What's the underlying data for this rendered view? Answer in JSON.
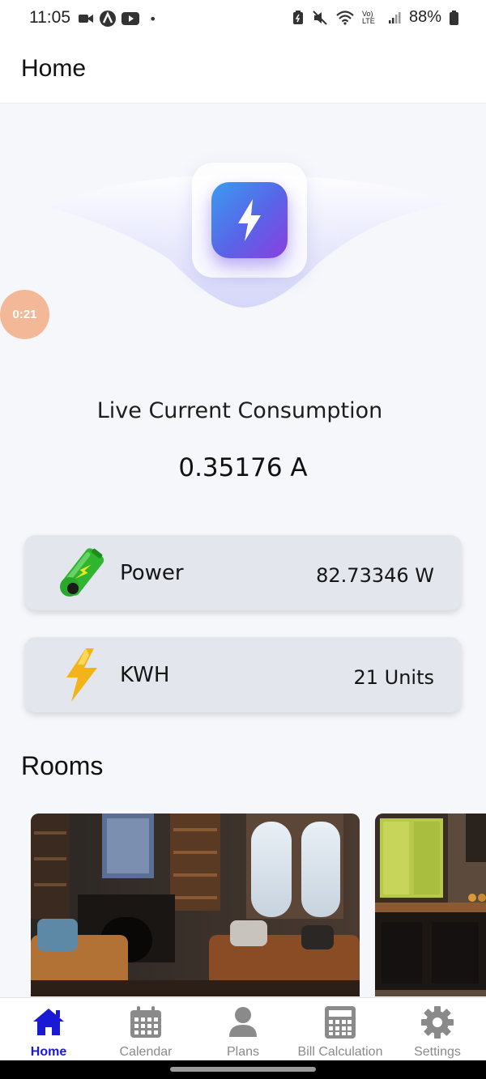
{
  "status_bar": {
    "time": "11:05",
    "dot": "•",
    "volte": "Vo) LTE",
    "battery": "88%"
  },
  "header": {
    "title": "Home"
  },
  "timer_badge": "0:21",
  "consumption": {
    "label": "Live Current Consumption",
    "value": "0.35176 A"
  },
  "cards": [
    {
      "label": "Power",
      "value": "82.73346 W",
      "icon": "battery-icon"
    },
    {
      "label": "KWH",
      "value": "21 Units",
      "icon": "lightning-icon"
    }
  ],
  "rooms": {
    "title": "Rooms",
    "items": [
      {
        "image": "living-room-image"
      },
      {
        "image": "kitchen-image"
      }
    ]
  },
  "nav": {
    "items": [
      {
        "label": "Home",
        "icon": "home-icon",
        "active": true
      },
      {
        "label": "Calendar",
        "icon": "calendar-icon",
        "active": false
      },
      {
        "label": "Plans",
        "icon": "person-icon",
        "active": false
      },
      {
        "label": "Bill Calculation",
        "icon": "calculator-icon",
        "active": false
      },
      {
        "label": "Settings",
        "icon": "gear-icon",
        "active": false
      }
    ]
  },
  "colors": {
    "accent": "#1a1ad6",
    "background": "#f6f7fb",
    "card": "#e3e6ed",
    "timer": "#f3b898"
  }
}
